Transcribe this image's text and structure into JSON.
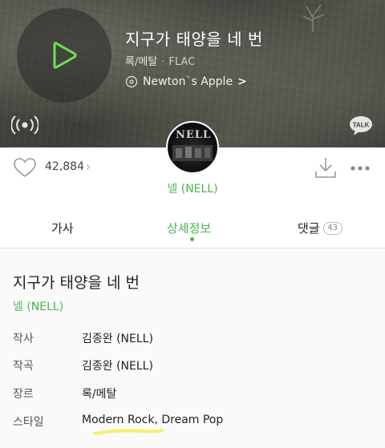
{
  "player": {
    "title": "지구가 태양을 네 번",
    "genre": "록/메탈",
    "separator": "·",
    "format": "FLAC",
    "album": "Newton`s Apple",
    "album_chevron": ">",
    "talk_label": "TALK"
  },
  "artist": {
    "avatar_text": "NELL",
    "name": "넬 (NELL)"
  },
  "actions": {
    "like_count": "42,884",
    "like_chevron": "›"
  },
  "tabs": [
    {
      "label": "가사"
    },
    {
      "label": "상세정보"
    },
    {
      "label": "댓글",
      "count": "43"
    }
  ],
  "details": {
    "title": "지구가 태양을 네 번",
    "artist": "넬 (NELL)",
    "rows": [
      {
        "label": "작사",
        "value": "김종완 (NELL)"
      },
      {
        "label": "작곡",
        "value": "김종완 (NELL)"
      },
      {
        "label": "장르",
        "value": "록/메탈"
      },
      {
        "label": "스타일",
        "styles": [
          "Modern Rock",
          "Dream Pop"
        ],
        "style_separator": ", "
      }
    ]
  },
  "colors": {
    "accent": "#4db34f",
    "play_icon": "#6ee05a",
    "highlight": "#f3f06a"
  }
}
